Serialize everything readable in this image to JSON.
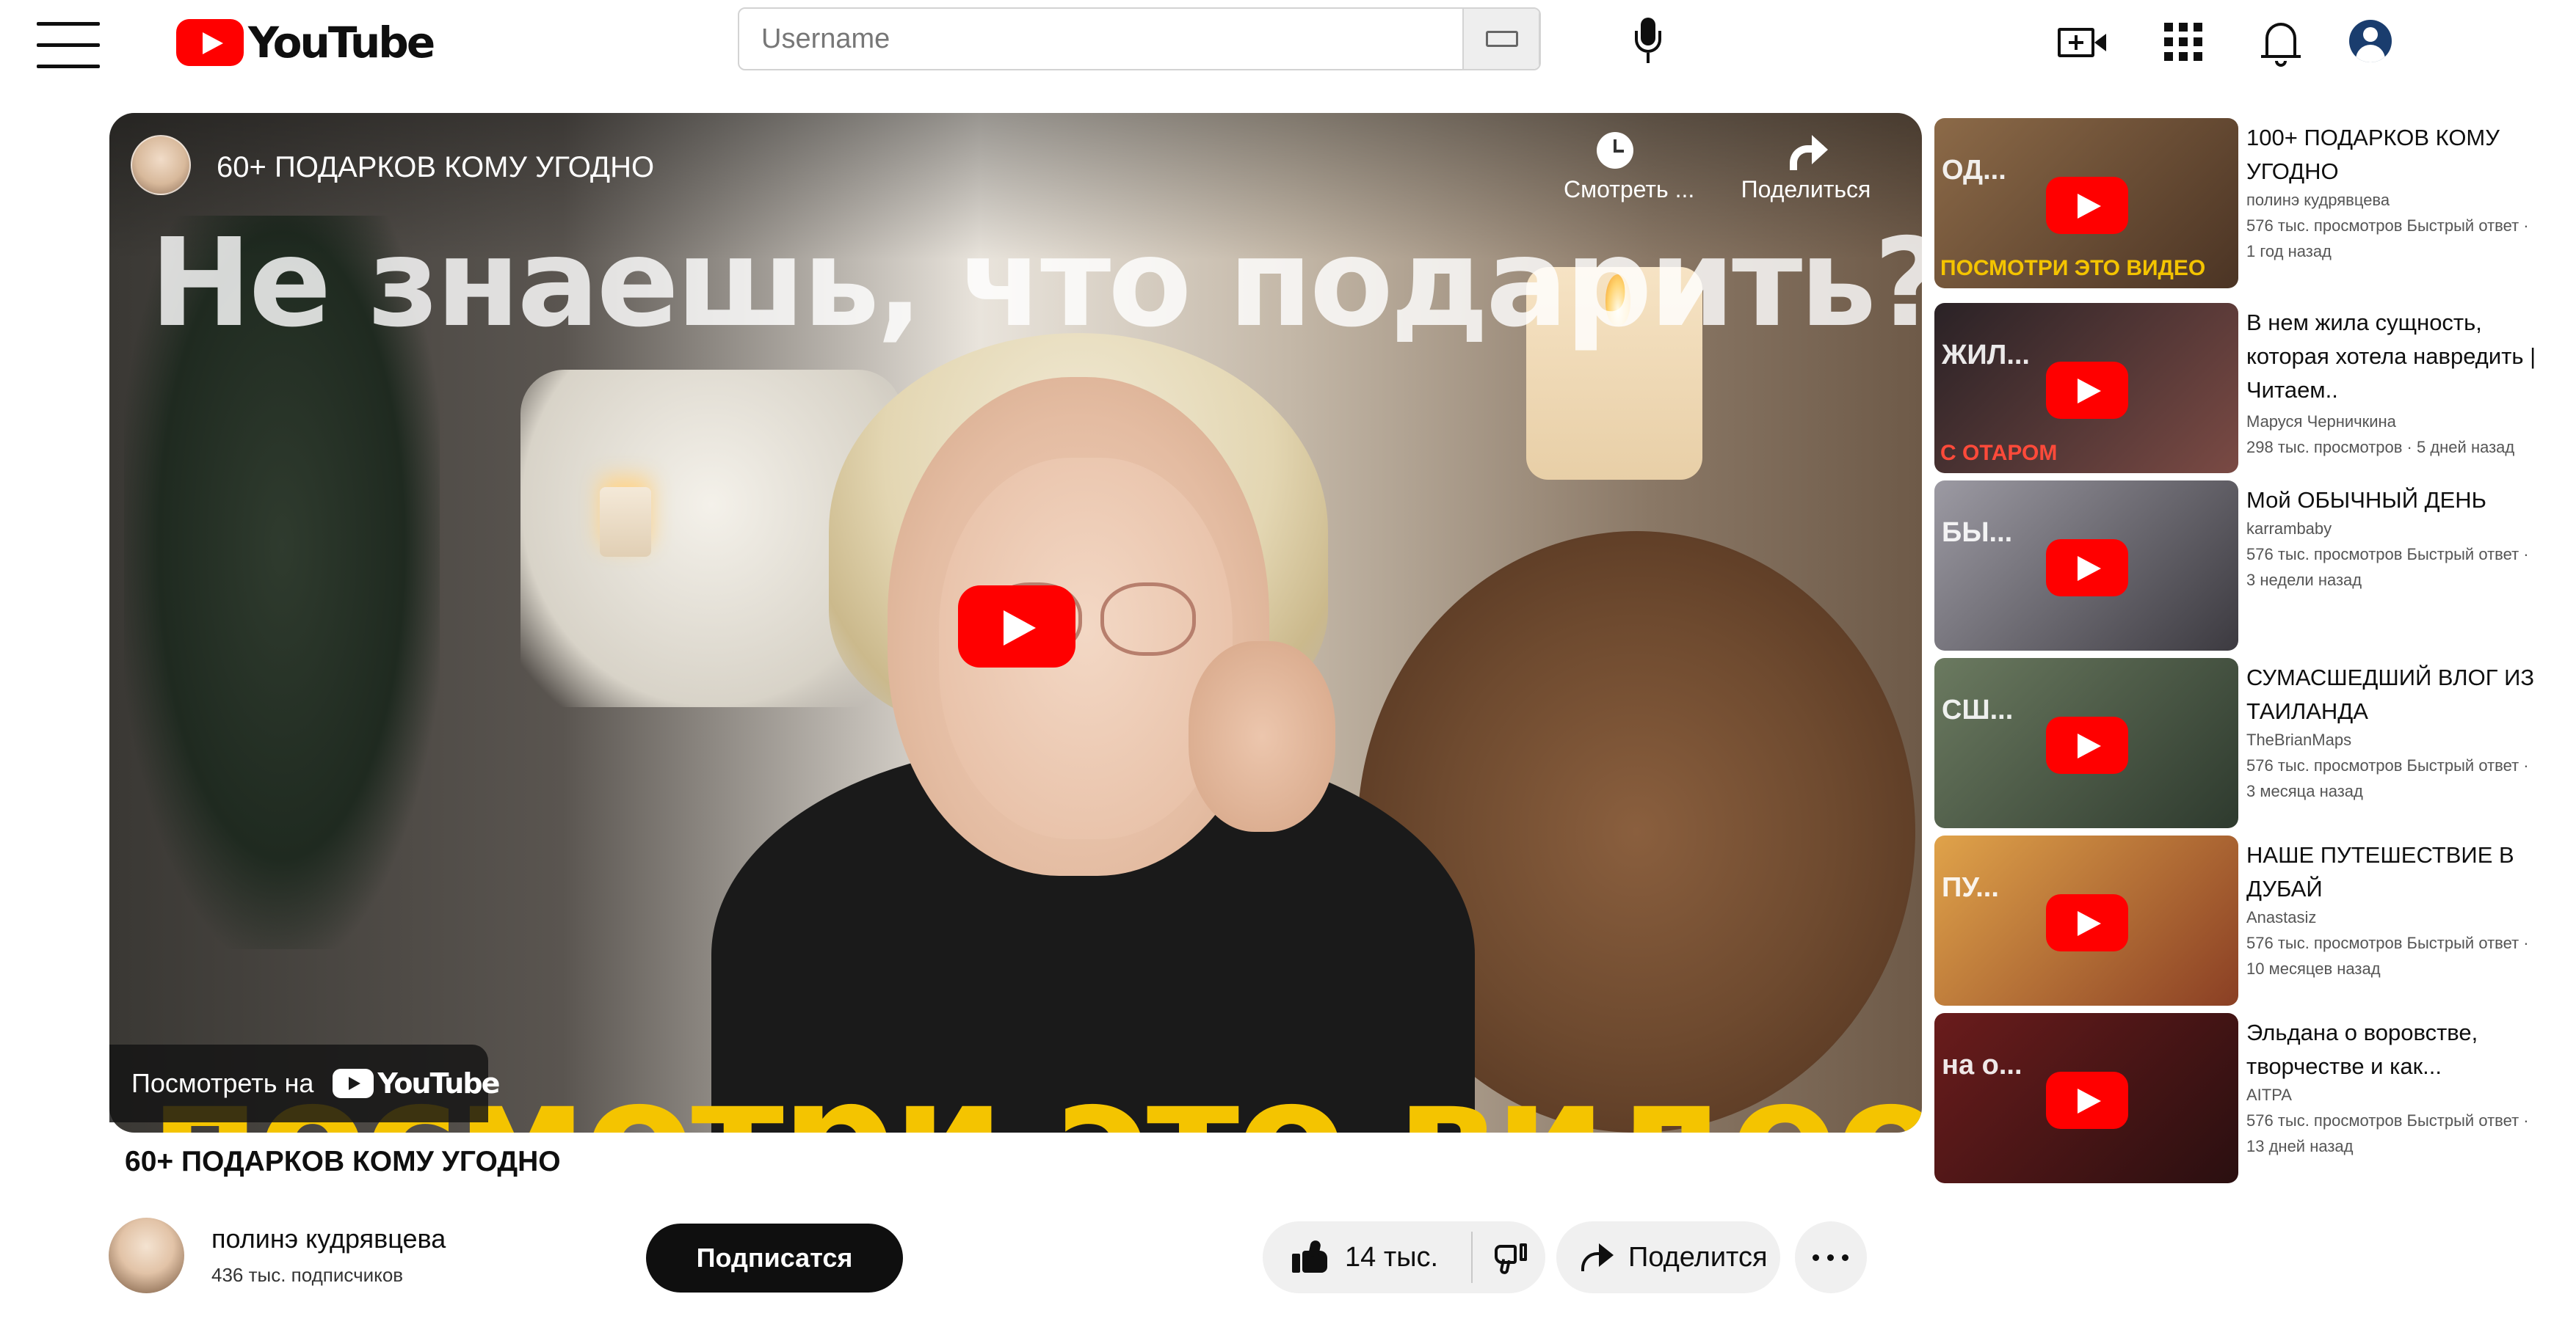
{
  "header": {
    "logo_text": "YouTube",
    "search_placeholder": "Username"
  },
  "player": {
    "title": "60+ ПОДАРКОВ КОМУ УГОДНО",
    "thumbnail_headline": "Не знаешь, что подарить?",
    "thumbnail_bottom": "посмотри это видео",
    "watch_later_label": "Смотреть ...",
    "share_label": "Поделиться",
    "watch_on_label": "Посмотреть на",
    "watch_on_logo": "YouTube"
  },
  "video": {
    "title": "60+ ПОДАРКОВ КОМУ УГОДНО",
    "channel_name": "полинэ кудрявцева",
    "subscribers": "436 тыс. подписчиков",
    "subscribe_label": "Подписатся",
    "likes": "14 тыс.",
    "share_label": "Поделится"
  },
  "recommendations": [
    {
      "title": "100+ ПОДАРКОВ КОМУ УГОДНО",
      "channel": "полинэ кудрявцева",
      "views": "576 тыс. просмотров Быстрый ответ ·",
      "age": "1 год назад",
      "thumb_top": "ОД...",
      "thumb_bottom": "ПОСМОТРИ ЭТО ВИДЕО",
      "thumb_color": "#7a5a3e"
    },
    {
      "title": "В нем жила сущность, которая хотела навредить | Читаем..",
      "channel": "Маруся Черничкина",
      "views": "298 тыс. просмотров · 5 дней назад",
      "age": "",
      "thumb_top": "ЖИЛ...",
      "thumb_bottom": "С ОТАРОМ",
      "thumb_color": "#3a2a30"
    },
    {
      "title": "Мой ОБЫЧНЫЙ ДЕНЬ",
      "channel": "karrambaby",
      "views": "576 тыс. просмотров Быстрый ответ ·",
      "age": "3 недели назад",
      "thumb_top": "БЫ...",
      "thumb_bottom": "",
      "thumb_color": "#6d6a70"
    },
    {
      "title": "СУМАСШЕДШИЙ ВЛОГ ИЗ ТАИЛАНДА",
      "channel": "TheBrianMaps",
      "views": "576 тыс. просмотров Быстрый ответ ·",
      "age": "3 месяца назад",
      "thumb_top": "СШ...",
      "thumb_bottom": "",
      "thumb_color": "#4a5a48"
    },
    {
      "title": "НАШЕ ПУТЕШЕСТВИЕ В ДУБАЙ",
      "channel": "Anastasiz",
      "views": "576 тыс. просмотров Быстрый ответ ·",
      "age": "10 месяцев назад",
      "thumb_top": "ПУ...",
      "thumb_bottom": "",
      "thumb_color": "#c07a3a"
    },
    {
      "title": "Эльдана о воровстве, творчестве и как...",
      "channel": "AITPA",
      "views": "576 тыс. просмотров Быстрый ответ ·",
      "age": "13 дней назад",
      "thumb_top": "на о...",
      "thumb_bottom": "",
      "thumb_color": "#5a1e1e"
    }
  ],
  "colors": {
    "brand_red": "#ff0000",
    "thumb_yellow": "#f4c400",
    "button_dark": "#0f0f0f",
    "chip_gray": "#f0f0f0"
  },
  "icons": [
    "menu-icon",
    "youtube-logo-icon",
    "keyboard-icon",
    "search-icon",
    "mic-icon",
    "create-icon",
    "apps-icon",
    "bell-icon",
    "account-icon",
    "clock-icon",
    "share-icon",
    "play-icon",
    "like-icon",
    "dislike-icon",
    "more-icon"
  ]
}
